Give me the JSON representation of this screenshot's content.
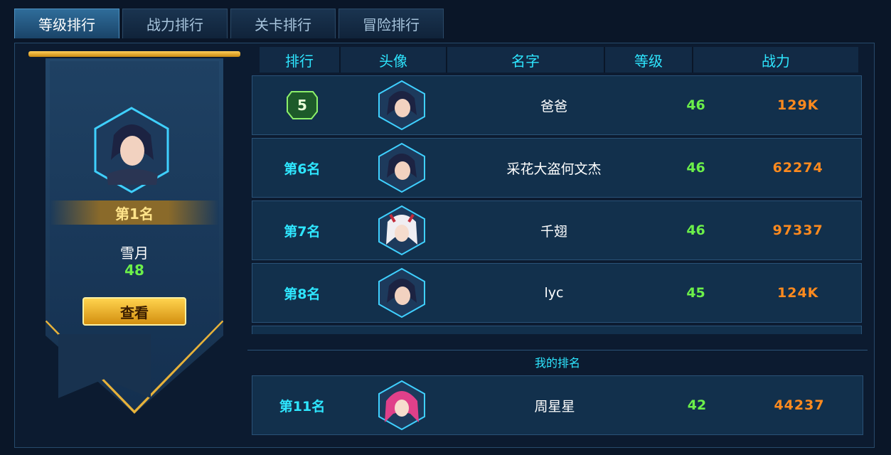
{
  "tabs": [
    "等级排行",
    "战力排行",
    "关卡排行",
    "冒险排行"
  ],
  "active_tab": 0,
  "top_player": {
    "rank_label": "第1名",
    "name": "雪月",
    "level": "48",
    "view_button": "查看"
  },
  "table": {
    "headers": {
      "rank": "排行",
      "avatar": "头像",
      "name": "名字",
      "level": "等级",
      "power": "战力"
    },
    "rows": [
      {
        "rank": "5",
        "name": "爸爸",
        "level": "46",
        "power": "129K",
        "avatar": "dark-hair-female-avatar"
      },
      {
        "rank": "第6名",
        "name": "采花大盗何文杰",
        "level": "46",
        "power": "62274",
        "avatar": "dark-hair-female-avatar"
      },
      {
        "rank": "第7名",
        "name": "千翅",
        "level": "46",
        "power": "97337",
        "avatar": "white-hair-female-avatar"
      },
      {
        "rank": "第8名",
        "name": "lyc",
        "level": "45",
        "power": "124K",
        "avatar": "dark-hair-female-avatar"
      }
    ]
  },
  "my_rank": {
    "title": "我的排名",
    "rank": "第11名",
    "name": "周星星",
    "level": "42",
    "power": "44237",
    "avatar": "pink-hair-female-avatar"
  },
  "colors": {
    "accent_cyan": "#2ee6ff",
    "level_green": "#6cf04a",
    "power_orange": "#ff8a1e",
    "gold": "#ffd34e"
  }
}
